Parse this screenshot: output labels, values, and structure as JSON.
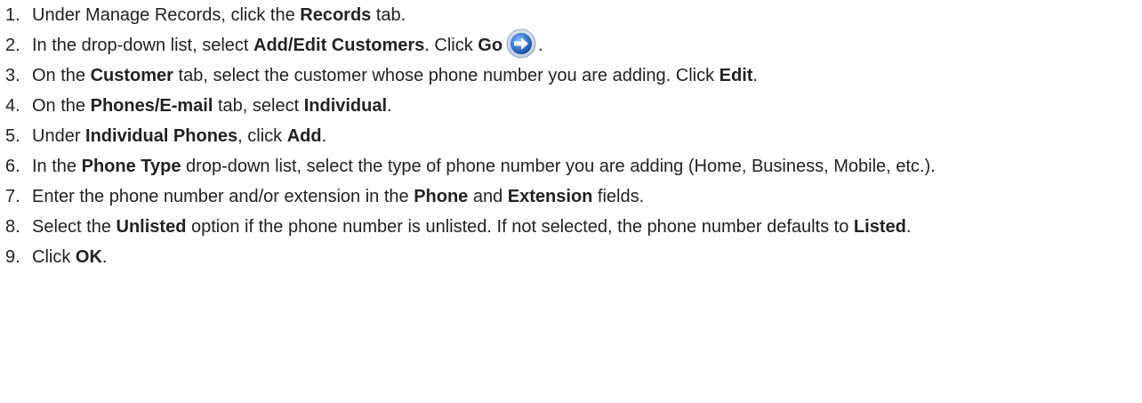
{
  "steps": [
    {
      "num": "1.",
      "parts": [
        {
          "t": "Under Manage Records, click the "
        },
        {
          "t": "Records",
          "b": true
        },
        {
          "t": " tab."
        }
      ]
    },
    {
      "num": "2.",
      "parts": [
        {
          "t": "In the drop-down list, select "
        },
        {
          "t": "Add/Edit Customers",
          "b": true
        },
        {
          "t": ". Click "
        },
        {
          "t": "Go",
          "b": true
        },
        {
          "icon": "go-arrow-icon"
        },
        {
          "t": "."
        }
      ]
    },
    {
      "num": "3.",
      "parts": [
        {
          "t": "On the "
        },
        {
          "t": "Customer",
          "b": true
        },
        {
          "t": " tab, select the customer whose phone number you are adding. Click "
        },
        {
          "t": "Edit",
          "b": true
        },
        {
          "t": "."
        }
      ]
    },
    {
      "num": "4.",
      "parts": [
        {
          "t": "On the "
        },
        {
          "t": "Phones/E-mail",
          "b": true
        },
        {
          "t": " tab, select "
        },
        {
          "t": "Individual",
          "b": true
        },
        {
          "t": "."
        }
      ]
    },
    {
      "num": "5.",
      "parts": [
        {
          "t": "Under "
        },
        {
          "t": "Individual Phones",
          "b": true
        },
        {
          "t": ", click "
        },
        {
          "t": "Add",
          "b": true
        },
        {
          "t": "."
        }
      ]
    },
    {
      "num": "6.",
      "parts": [
        {
          "t": "In the "
        },
        {
          "t": "Phone Type",
          "b": true
        },
        {
          "t": " drop-down list, select the type of phone number you are adding (Home, Business, Mobile, etc.)."
        }
      ]
    },
    {
      "num": "7.",
      "parts": [
        {
          "t": "Enter the phone number and/or extension in the "
        },
        {
          "t": "Phone",
          "b": true
        },
        {
          "t": " and "
        },
        {
          "t": "Extension",
          "b": true
        },
        {
          "t": " fields."
        }
      ]
    },
    {
      "num": "8.",
      "parts": [
        {
          "t": "Select the "
        },
        {
          "t": "Unlisted",
          "b": true
        },
        {
          "t": " option if the phone number is unlisted. If not selected, the phone number defaults to "
        },
        {
          "t": "Listed",
          "b": true
        },
        {
          "t": "."
        }
      ]
    },
    {
      "num": "9.",
      "parts": [
        {
          "t": "Click "
        },
        {
          "t": "OK",
          "b": true
        },
        {
          "t": "."
        }
      ]
    }
  ],
  "colors": {
    "text": "#222222",
    "icon_blue": "#2f6fc9",
    "icon_ring": "#cfd9e8"
  }
}
